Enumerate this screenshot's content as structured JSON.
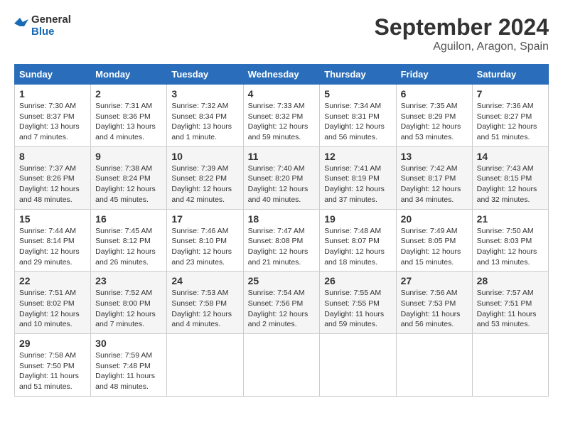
{
  "header": {
    "logo_line1": "General",
    "logo_line2": "Blue",
    "month": "September 2024",
    "location": "Aguilon, Aragon, Spain"
  },
  "weekdays": [
    "Sunday",
    "Monday",
    "Tuesday",
    "Wednesday",
    "Thursday",
    "Friday",
    "Saturday"
  ],
  "weeks": [
    [
      {
        "day": "1",
        "sunrise": "Sunrise: 7:30 AM",
        "sunset": "Sunset: 8:37 PM",
        "daylight": "Daylight: 13 hours and 7 minutes."
      },
      {
        "day": "2",
        "sunrise": "Sunrise: 7:31 AM",
        "sunset": "Sunset: 8:36 PM",
        "daylight": "Daylight: 13 hours and 4 minutes."
      },
      {
        "day": "3",
        "sunrise": "Sunrise: 7:32 AM",
        "sunset": "Sunset: 8:34 PM",
        "daylight": "Daylight: 13 hours and 1 minute."
      },
      {
        "day": "4",
        "sunrise": "Sunrise: 7:33 AM",
        "sunset": "Sunset: 8:32 PM",
        "daylight": "Daylight: 12 hours and 59 minutes."
      },
      {
        "day": "5",
        "sunrise": "Sunrise: 7:34 AM",
        "sunset": "Sunset: 8:31 PM",
        "daylight": "Daylight: 12 hours and 56 minutes."
      },
      {
        "day": "6",
        "sunrise": "Sunrise: 7:35 AM",
        "sunset": "Sunset: 8:29 PM",
        "daylight": "Daylight: 12 hours and 53 minutes."
      },
      {
        "day": "7",
        "sunrise": "Sunrise: 7:36 AM",
        "sunset": "Sunset: 8:27 PM",
        "daylight": "Daylight: 12 hours and 51 minutes."
      }
    ],
    [
      {
        "day": "8",
        "sunrise": "Sunrise: 7:37 AM",
        "sunset": "Sunset: 8:26 PM",
        "daylight": "Daylight: 12 hours and 48 minutes."
      },
      {
        "day": "9",
        "sunrise": "Sunrise: 7:38 AM",
        "sunset": "Sunset: 8:24 PM",
        "daylight": "Daylight: 12 hours and 45 minutes."
      },
      {
        "day": "10",
        "sunrise": "Sunrise: 7:39 AM",
        "sunset": "Sunset: 8:22 PM",
        "daylight": "Daylight: 12 hours and 42 minutes."
      },
      {
        "day": "11",
        "sunrise": "Sunrise: 7:40 AM",
        "sunset": "Sunset: 8:20 PM",
        "daylight": "Daylight: 12 hours and 40 minutes."
      },
      {
        "day": "12",
        "sunrise": "Sunrise: 7:41 AM",
        "sunset": "Sunset: 8:19 PM",
        "daylight": "Daylight: 12 hours and 37 minutes."
      },
      {
        "day": "13",
        "sunrise": "Sunrise: 7:42 AM",
        "sunset": "Sunset: 8:17 PM",
        "daylight": "Daylight: 12 hours and 34 minutes."
      },
      {
        "day": "14",
        "sunrise": "Sunrise: 7:43 AM",
        "sunset": "Sunset: 8:15 PM",
        "daylight": "Daylight: 12 hours and 32 minutes."
      }
    ],
    [
      {
        "day": "15",
        "sunrise": "Sunrise: 7:44 AM",
        "sunset": "Sunset: 8:14 PM",
        "daylight": "Daylight: 12 hours and 29 minutes."
      },
      {
        "day": "16",
        "sunrise": "Sunrise: 7:45 AM",
        "sunset": "Sunset: 8:12 PM",
        "daylight": "Daylight: 12 hours and 26 minutes."
      },
      {
        "day": "17",
        "sunrise": "Sunrise: 7:46 AM",
        "sunset": "Sunset: 8:10 PM",
        "daylight": "Daylight: 12 hours and 23 minutes."
      },
      {
        "day": "18",
        "sunrise": "Sunrise: 7:47 AM",
        "sunset": "Sunset: 8:08 PM",
        "daylight": "Daylight: 12 hours and 21 minutes."
      },
      {
        "day": "19",
        "sunrise": "Sunrise: 7:48 AM",
        "sunset": "Sunset: 8:07 PM",
        "daylight": "Daylight: 12 hours and 18 minutes."
      },
      {
        "day": "20",
        "sunrise": "Sunrise: 7:49 AM",
        "sunset": "Sunset: 8:05 PM",
        "daylight": "Daylight: 12 hours and 15 minutes."
      },
      {
        "day": "21",
        "sunrise": "Sunrise: 7:50 AM",
        "sunset": "Sunset: 8:03 PM",
        "daylight": "Daylight: 12 hours and 13 minutes."
      }
    ],
    [
      {
        "day": "22",
        "sunrise": "Sunrise: 7:51 AM",
        "sunset": "Sunset: 8:02 PM",
        "daylight": "Daylight: 12 hours and 10 minutes."
      },
      {
        "day": "23",
        "sunrise": "Sunrise: 7:52 AM",
        "sunset": "Sunset: 8:00 PM",
        "daylight": "Daylight: 12 hours and 7 minutes."
      },
      {
        "day": "24",
        "sunrise": "Sunrise: 7:53 AM",
        "sunset": "Sunset: 7:58 PM",
        "daylight": "Daylight: 12 hours and 4 minutes."
      },
      {
        "day": "25",
        "sunrise": "Sunrise: 7:54 AM",
        "sunset": "Sunset: 7:56 PM",
        "daylight": "Daylight: 12 hours and 2 minutes."
      },
      {
        "day": "26",
        "sunrise": "Sunrise: 7:55 AM",
        "sunset": "Sunset: 7:55 PM",
        "daylight": "Daylight: 11 hours and 59 minutes."
      },
      {
        "day": "27",
        "sunrise": "Sunrise: 7:56 AM",
        "sunset": "Sunset: 7:53 PM",
        "daylight": "Daylight: 11 hours and 56 minutes."
      },
      {
        "day": "28",
        "sunrise": "Sunrise: 7:57 AM",
        "sunset": "Sunset: 7:51 PM",
        "daylight": "Daylight: 11 hours and 53 minutes."
      }
    ],
    [
      {
        "day": "29",
        "sunrise": "Sunrise: 7:58 AM",
        "sunset": "Sunset: 7:50 PM",
        "daylight": "Daylight: 11 hours and 51 minutes."
      },
      {
        "day": "30",
        "sunrise": "Sunrise: 7:59 AM",
        "sunset": "Sunset: 7:48 PM",
        "daylight": "Daylight: 11 hours and 48 minutes."
      },
      null,
      null,
      null,
      null,
      null
    ]
  ]
}
